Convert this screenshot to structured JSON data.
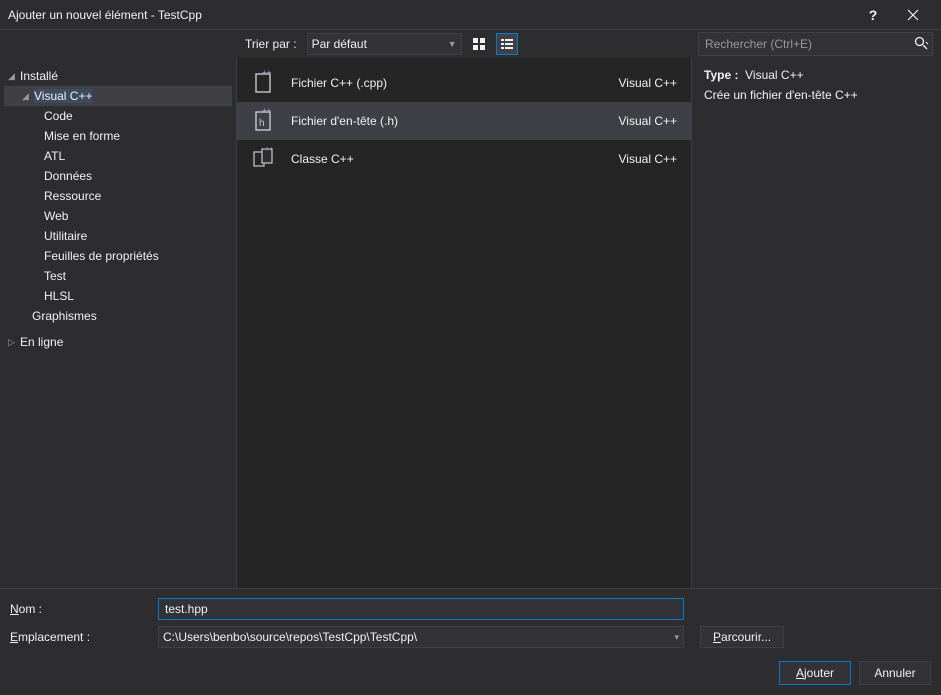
{
  "title": "Ajouter un nouvel élément - TestCpp",
  "sort_label": "Trier par :",
  "sort_value": "Par défaut",
  "search_placeholder": "Rechercher (Ctrl+E)",
  "tree": {
    "installed": "Installé",
    "visualcpp": "Visual C++",
    "children": [
      "Code",
      "Mise en forme",
      "ATL",
      "Données",
      "Ressource",
      "Web",
      "Utilitaire",
      "Feuilles de propriétés",
      "Test",
      "HLSL"
    ],
    "graphics": "Graphismes",
    "online": "En ligne"
  },
  "items": [
    {
      "label": "Fichier C++ (.cpp)",
      "lang": "Visual C++"
    },
    {
      "label": "Fichier d'en-tête (.h)",
      "lang": "Visual C++"
    },
    {
      "label": "Classe C++",
      "lang": "Visual C++"
    }
  ],
  "details": {
    "type_label": "Type :",
    "type_value": "Visual C++",
    "description": "Crée un fichier d'en-tête C++"
  },
  "form": {
    "name_label_prefix": "N",
    "name_label_suffix": "om :",
    "name_value": "test.hpp",
    "location_label_prefix": "E",
    "location_label_suffix": "mplacement :",
    "location_value": "C:\\Users\\benbo\\source\\repos\\TestCpp\\TestCpp\\",
    "browse_prefix": "P",
    "browse_suffix": "arcourir..."
  },
  "actions": {
    "add_prefix": "A",
    "add_suffix": "jouter",
    "cancel": "Annuler"
  }
}
